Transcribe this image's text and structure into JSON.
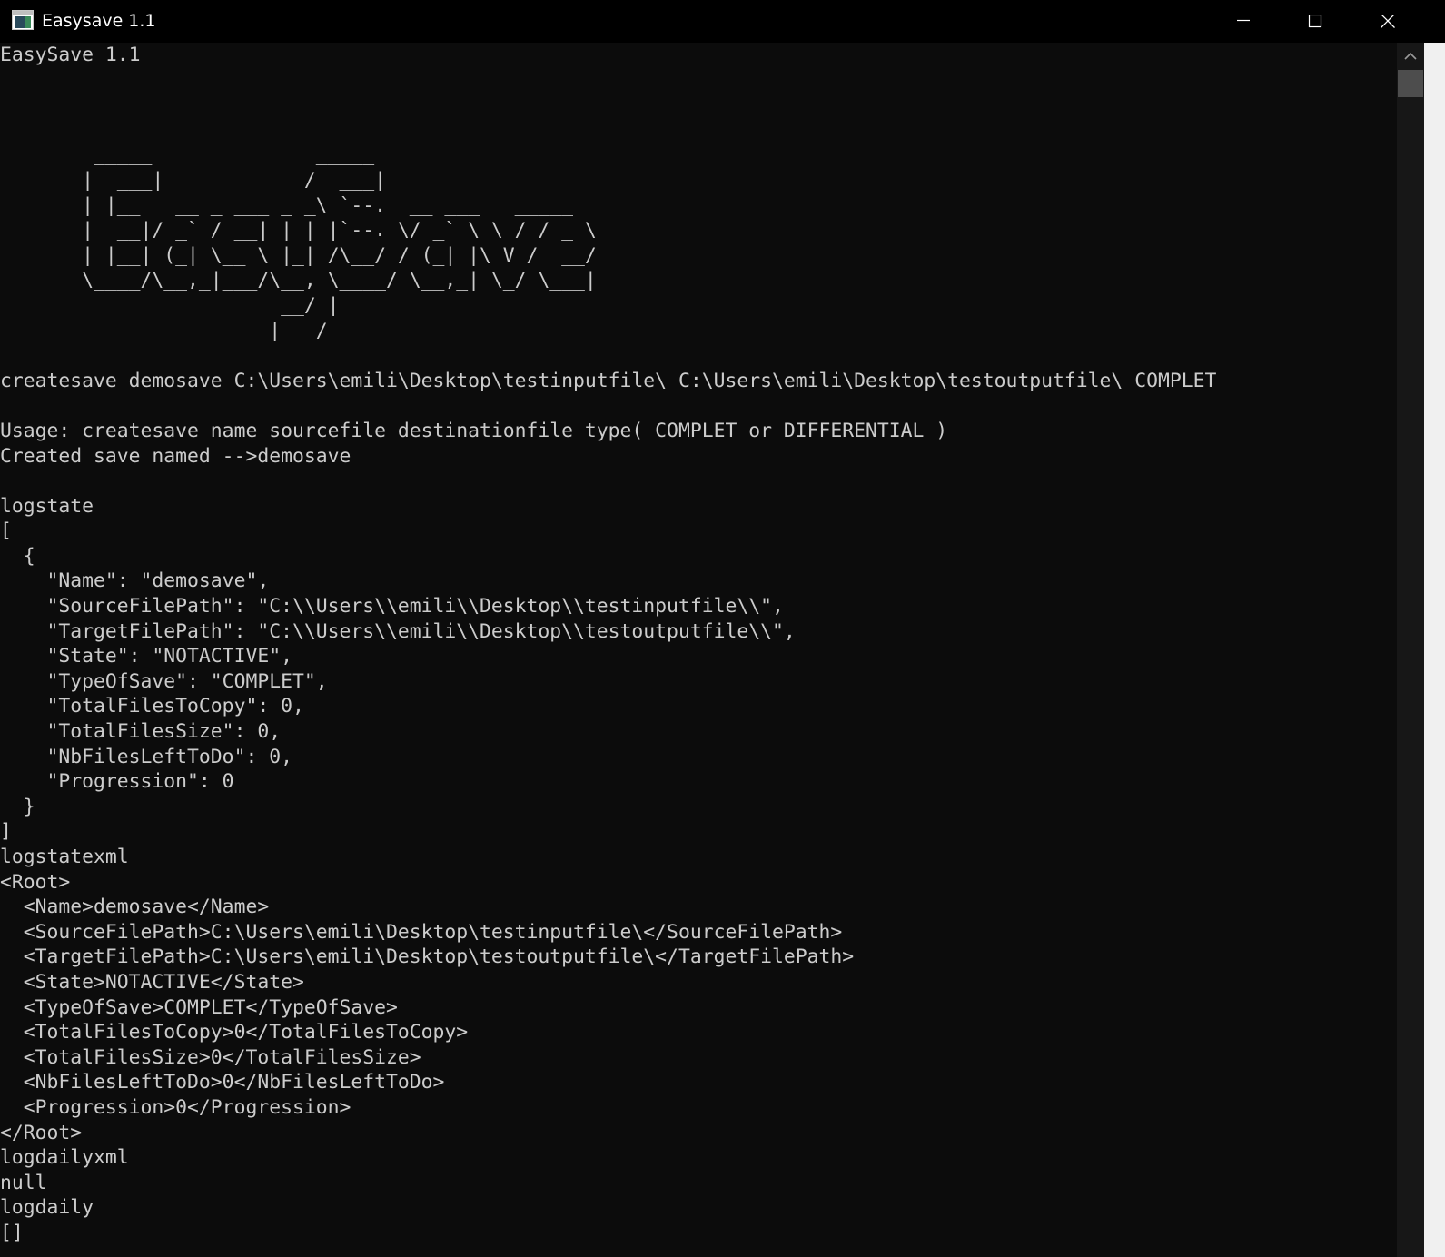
{
  "window": {
    "title": "Easysave 1.1",
    "controls": {
      "minimize_icon": "minimize-icon",
      "maximize_icon": "maximize-icon",
      "close_icon": "close-icon"
    }
  },
  "console": {
    "lines": [
      "EasySave 1.1",
      "",
      "",
      "",
      "        _____              _____",
      "       |  ___|            /  ___|",
      "       | |__   __ _ ___ _ _\\ `--.  __ ___   _____",
      "       |  __|/ _` / __| | | |`--. \\/ _` \\ \\ / / _ \\",
      "       | |__| (_| \\__ \\ |_| /\\__/ / (_| |\\ V /  __/",
      "       \\____/\\__,_|___/\\__, \\____/ \\__,_| \\_/ \\___|",
      "                        __/ |",
      "                       |___/",
      "",
      "createsave demosave C:\\Users\\emili\\Desktop\\testinputfile\\ C:\\Users\\emili\\Desktop\\testoutputfile\\ COMPLET",
      "",
      "Usage: createsave name sourcefile destinationfile type( COMPLET or DIFFERENTIAL )",
      "Created save named -->demosave",
      "",
      "logstate",
      "[",
      "  {",
      "    \"Name\": \"demosave\",",
      "    \"SourceFilePath\": \"C:\\\\Users\\\\emili\\\\Desktop\\\\testinputfile\\\\\",",
      "    \"TargetFilePath\": \"C:\\\\Users\\\\emili\\\\Desktop\\\\testoutputfile\\\\\",",
      "    \"State\": \"NOTACTIVE\",",
      "    \"TypeOfSave\": \"COMPLET\",",
      "    \"TotalFilesToCopy\": 0,",
      "    \"TotalFilesSize\": 0,",
      "    \"NbFilesLeftToDo\": 0,",
      "    \"Progression\": 0",
      "  }",
      "]",
      "logstatexml",
      "<Root>",
      "  <Name>demosave</Name>",
      "  <SourceFilePath>C:\\Users\\emili\\Desktop\\testinputfile\\</SourceFilePath>",
      "  <TargetFilePath>C:\\Users\\emili\\Desktop\\testoutputfile\\</TargetFilePath>",
      "  <State>NOTACTIVE</State>",
      "  <TypeOfSave>COMPLET</TypeOfSave>",
      "  <TotalFilesToCopy>0</TotalFilesToCopy>",
      "  <TotalFilesSize>0</TotalFilesSize>",
      "  <NbFilesLeftToDo>0</NbFilesLeftToDo>",
      "  <Progression>0</Progression>",
      "</Root>",
      "logdailyxml",
      "null",
      "logdaily",
      "[]"
    ]
  },
  "scrollbar": {
    "up_icon": "scroll-up-arrow-icon",
    "position": 0
  },
  "colors": {
    "titlebar_bg": "#000000",
    "console_bg": "#0c0c0c",
    "console_text": "#cccccc",
    "scroll_track": "#171717",
    "scroll_thumb": "#4d4d4d"
  }
}
